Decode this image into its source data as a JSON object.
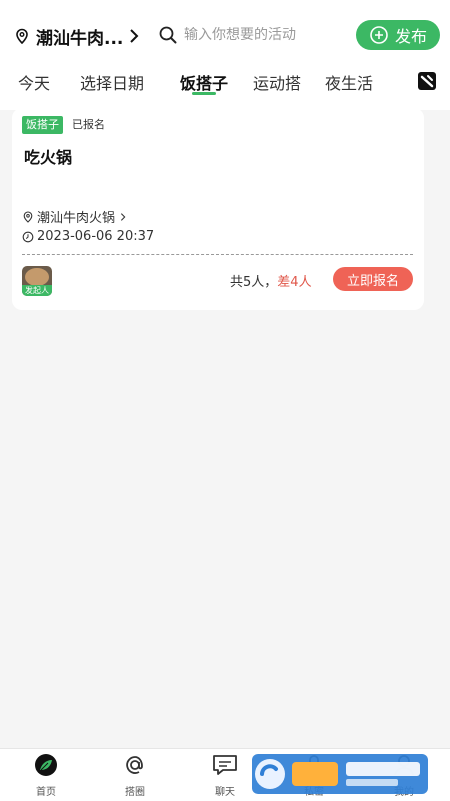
{
  "header": {
    "location": "潮汕牛肉...",
    "search_placeholder": "输入你想要的活动",
    "publish_label": "发布"
  },
  "tabs": [
    {
      "label": "今天"
    },
    {
      "label": "选择日期"
    },
    {
      "label": "饭搭子",
      "active": true
    },
    {
      "label": "运动搭"
    },
    {
      "label": "夜生活"
    }
  ],
  "card": {
    "category": "饭搭子",
    "status": "已报名",
    "title": "吃火锅",
    "address": "潮汕牛肉火锅",
    "datetime": "2023-06-06 20:37",
    "owner_badge": "发起人",
    "total_people": "共5人",
    "separator": "，",
    "short_people": "差4人",
    "join_label": "立即报名"
  },
  "bottom_nav": [
    {
      "label": "首页",
      "icon": "leaf-icon",
      "active": true
    },
    {
      "label": "搭圈",
      "icon": "at-icon"
    },
    {
      "label": "聊天",
      "icon": "chat-icon"
    },
    {
      "label": "私密",
      "icon": "lock-icon"
    },
    {
      "label": "我的",
      "icon": "user-icon"
    }
  ],
  "colors": {
    "accent": "#3cb864",
    "join_button": "#ef6356",
    "shortage_text": "#e0574a"
  }
}
